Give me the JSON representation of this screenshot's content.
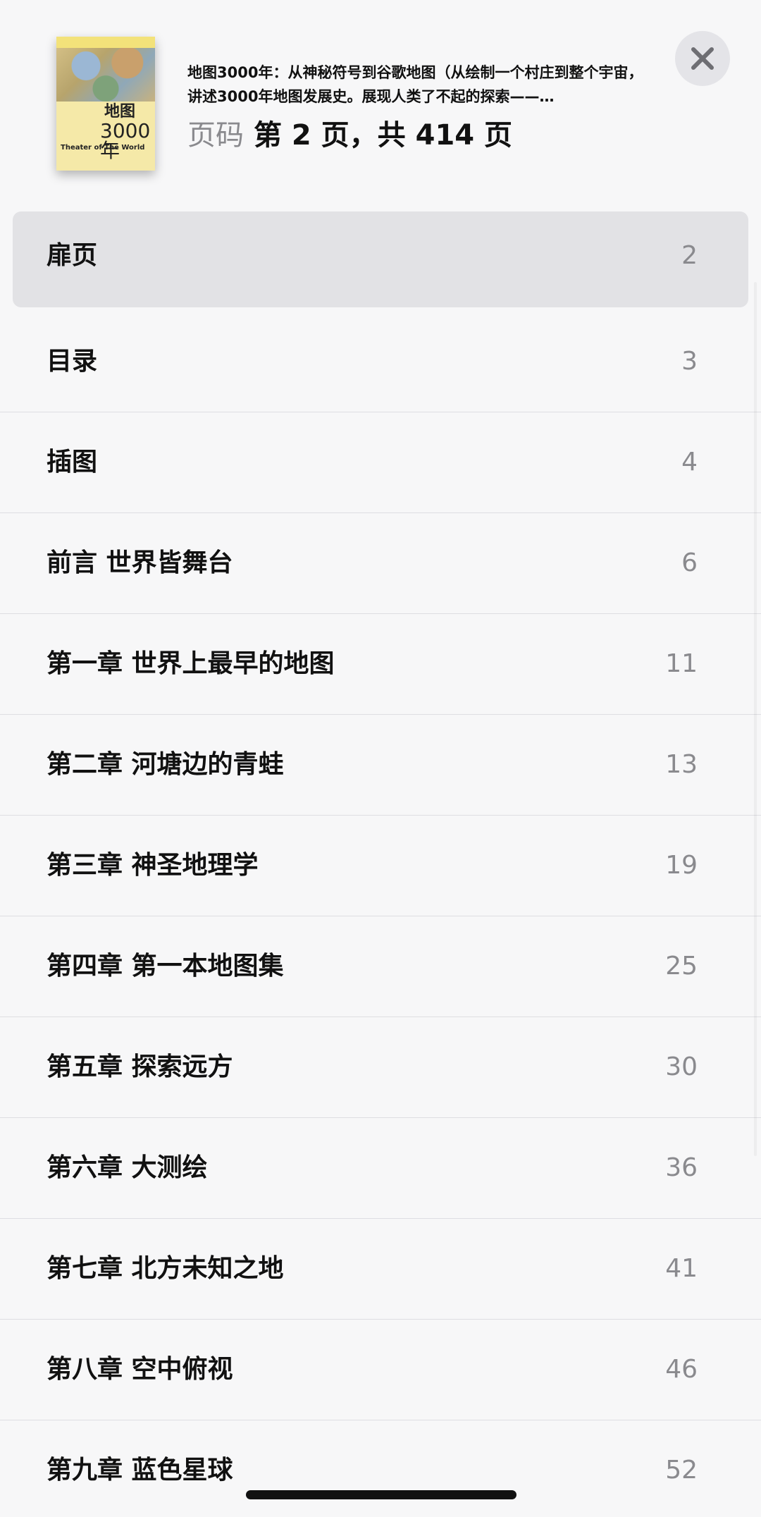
{
  "header": {
    "book_title": "地图3000年：从神秘符号到谷歌地图（从绘制一个村庄到整个宇宙，讲述3000年地图发展史。展现人类了不起的探索——…",
    "page_label": "页码",
    "page_value": "第 2 页，共 414 页",
    "cover": {
      "title": "地图",
      "number": "3000",
      "year_char": "年",
      "english": "Theater of The World"
    },
    "close_icon": "close-icon"
  },
  "toc": [
    {
      "label": "扉页",
      "page": "2",
      "selected": true
    },
    {
      "label": "目录",
      "page": "3"
    },
    {
      "label": "插图",
      "page": "4"
    },
    {
      "label": "前言 世界皆舞台",
      "page": "6"
    },
    {
      "label": "第一章 世界上最早的地图",
      "page": "11"
    },
    {
      "label": "第二章 河塘边的青蛙",
      "page": "13"
    },
    {
      "label": "第三章 神圣地理学",
      "page": "19"
    },
    {
      "label": "第四章 第一本地图集",
      "page": "25"
    },
    {
      "label": "第五章 探索远方",
      "page": "30"
    },
    {
      "label": "第六章 大测绘",
      "page": "36"
    },
    {
      "label": "第七章 北方未知之地",
      "page": "41"
    },
    {
      "label": "第八章 空中俯视",
      "page": "46"
    },
    {
      "label": "第九章 蓝色星球",
      "page": "52"
    }
  ]
}
